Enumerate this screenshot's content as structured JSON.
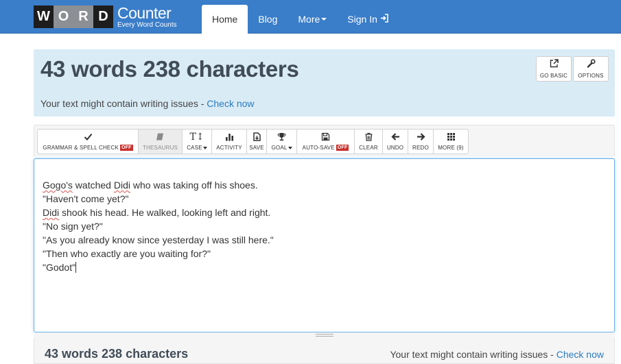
{
  "brand": {
    "tiles": [
      "W",
      "O",
      "R",
      "D"
    ],
    "name": "Counter",
    "tagline": "Every Word Counts"
  },
  "nav": {
    "items": [
      {
        "label": "Home",
        "active": true
      },
      {
        "label": "Blog"
      },
      {
        "label": "More"
      },
      {
        "label": "Sign In"
      }
    ]
  },
  "counts": {
    "headline": "43 words 238 characters",
    "issues_text": "Your text might contain writing issues - ",
    "issues_link": "Check now"
  },
  "top_buttons": [
    {
      "label": "GO BASIC",
      "icon": "external-link-icon"
    },
    {
      "label": "OPTIONS",
      "icon": "wrench-icon"
    }
  ],
  "toolbar": [
    {
      "label": "GRAMMAR & SPELL CHECK",
      "badge": "OFF",
      "icon": "check-icon"
    },
    {
      "label": "THESAURUS",
      "icon": "book-icon",
      "disabled": true
    },
    {
      "label": "CASE",
      "icon": "text-case-icon",
      "dropdown": true
    },
    {
      "label": "ACTIVITY",
      "icon": "bar-chart-icon"
    },
    {
      "label": "SAVE",
      "icon": "save-file-icon"
    },
    {
      "label": "GOAL",
      "icon": "trophy-icon",
      "dropdown": true
    },
    {
      "label": "AUTO-SAVE",
      "badge": "OFF",
      "icon": "floppy-icon"
    },
    {
      "label": "CLEAR",
      "icon": "trash-icon"
    },
    {
      "label": "UNDO",
      "icon": "arrow-left-icon"
    },
    {
      "label": "REDO",
      "icon": "arrow-right-icon"
    },
    {
      "label": "MORE (9)",
      "icon": "grid-icon"
    }
  ],
  "editor": {
    "lines": [
      {
        "parts": [
          {
            "t": "Gogo's",
            "spell": true
          },
          {
            "t": " watched "
          },
          {
            "t": "Didi",
            "spell": true
          },
          {
            "t": " who was taking off his shoes."
          }
        ]
      },
      {
        "parts": [
          {
            "t": "\"Haven't come yet?\""
          }
        ]
      },
      {
        "parts": [
          {
            "t": "Didi",
            "spell": true
          },
          {
            "t": " shook his head. He walked, looking left and right."
          }
        ]
      },
      {
        "parts": [
          {
            "t": "\"No sign yet?\""
          }
        ]
      },
      {
        "parts": [
          {
            "t": "\"As you already know since yesterday I was still here.\""
          }
        ]
      },
      {
        "parts": [
          {
            "t": "\"Then who exactly are you waiting for?\""
          }
        ]
      },
      {
        "parts": [
          {
            "t": "\"Godot\""
          }
        ],
        "cursor": true
      }
    ]
  },
  "footer": {
    "headline": "43 words 238 characters",
    "issues_text": "Your text might contain writing issues - ",
    "issues_link": "Check now"
  },
  "colors": {
    "navbar": "#3a7dc9",
    "count_box": "#d9ebf5",
    "link": "#2a7bbf",
    "off_badge": "#c9302c"
  }
}
